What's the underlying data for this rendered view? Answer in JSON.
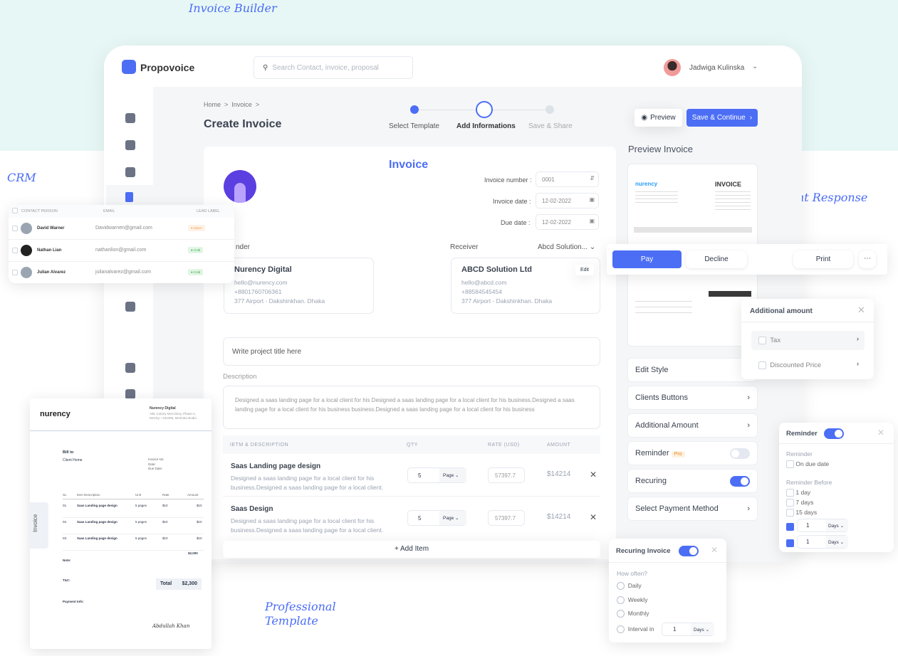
{
  "annotations": {
    "builder": "Invoice Builder",
    "crm": "CRM",
    "client_response": "Client Response",
    "template": "Professional Template"
  },
  "header": {
    "brand": "Propovoice",
    "search_placeholder": "Search Contact, invoice, proposal",
    "user": "Jadwiga Kulinska"
  },
  "breadcrumb": [
    "Home",
    "Invoice"
  ],
  "page_title": "Create Invoice",
  "steps": [
    {
      "label": "Select Template",
      "state": "done"
    },
    {
      "label": "Add Informations",
      "state": "current"
    },
    {
      "label": "Save & Share",
      "state": "todo"
    }
  ],
  "actions": {
    "preview": "Preview",
    "save": "Save & Continue"
  },
  "form": {
    "title": "Invoice",
    "invoice_number_label": "Invoice number :",
    "invoice_number": "0001",
    "invoice_date_label": "Invoice date :",
    "invoice_date": "12-02-2022",
    "due_date_label": "Due date :",
    "due_date": "12-02-2022",
    "sender_label": "nder",
    "receiver_label": "Receiver",
    "receiver_select": "Abcd Solution...",
    "sender": {
      "name": "Nurency Digital",
      "email": "hello@nurency.com",
      "phone": "+8801760706361",
      "address": "377 Airport - Dakshinkhan. Dhaka"
    },
    "receiver": {
      "name": "ABCD Solution Ltd",
      "email": "hello@abcd.com",
      "phone": "+88584545454",
      "address": "377 Airport - Dakshinkhan. Dhaka",
      "edit": "Edit"
    },
    "project_title_placeholder": "Write project title here",
    "description_label": "Description",
    "description": "Designed a saas landing page for a local client for his  Designed a saas landing page for a local client for his business.Designed a saas landing page for a local client for his business business.Designed a saas landing page for a local client for his business",
    "columns": [
      "IETM & DESCRIPTION",
      "QTY",
      "RATE (USD)",
      "AMOUNT"
    ],
    "items": [
      {
        "title": "Saas Landing page design",
        "desc": "Designed a saas landing page for a local client for his business.Designed a saas landing page for a local client.",
        "qty": "5",
        "unit": "Page",
        "rate": "57397.7",
        "amount": "$14214"
      },
      {
        "title": "Saas Design",
        "desc": "Designed a saas landing page for a local client for his business.Designed a saas landing page for a local client.",
        "qty": "5",
        "unit": "Page",
        "rate": "57397.7",
        "amount": "$14214"
      }
    ],
    "add_item": "Add Item"
  },
  "preview": {
    "title": "Preview Invoice",
    "mini_brand": "nurency",
    "mini_heading": "INVOICE"
  },
  "settings": [
    {
      "label": "Edit Style"
    },
    {
      "label": "Clients Buttons"
    },
    {
      "label": "Additional Amount"
    },
    {
      "label": "Reminder",
      "badge": "Pro",
      "toggle": false
    },
    {
      "label": "Recuring",
      "toggle": true
    },
    {
      "label": "Select Payment Method"
    }
  ],
  "client_response": {
    "pay": "Pay",
    "decline": "Decline",
    "print": "Print"
  },
  "additional": {
    "title": "Additional amount",
    "options": [
      "Tax",
      "Discounted Price"
    ]
  },
  "reminder": {
    "title": "Reminder",
    "enabled": true,
    "section1": "Reminder",
    "on_due": "On due date",
    "section2": "Reminder Before",
    "options": [
      "1 day",
      "7 days",
      "15 days"
    ],
    "custom": [
      {
        "value": "1",
        "unit": "Days"
      },
      {
        "value": "1",
        "unit": "Days"
      }
    ]
  },
  "recurring": {
    "title": "Recuring Invoice",
    "enabled": true,
    "question": "How often?",
    "options": [
      "Daily",
      "Weekly",
      "Monthly",
      "Interval in"
    ],
    "interval": "1",
    "interval_unit": "Days"
  },
  "crm": {
    "columns": [
      "CONTACT PERSON",
      "EMAIL",
      "LEAD LABEL"
    ],
    "rows": [
      {
        "name": "David Warner",
        "email": "Davidwarnen@gmail.com",
        "label": "Warm",
        "color": "#f6a04d"
      },
      {
        "name": "Nathan Lian",
        "email": "nathanlion@gmail.com",
        "label": "Cold",
        "color": "#2fb344"
      },
      {
        "name": "Julian Alvarez",
        "email": "julianalvarez@gmail.com",
        "label": "Cold",
        "color": "#2fb344"
      }
    ]
  },
  "template": {
    "brand": "nurency",
    "company": "Nurency Digital",
    "company_addr": "ABL Colony McColony, Phase-1, McCity—102456, McGrato Bodia",
    "side_tab": "Invoice",
    "bill_to": "Bill to",
    "client": "Client Home",
    "invoice_no": "Invoice No:",
    "date": "Date:",
    "due": "Due Date:",
    "columns": [
      "SL.",
      "Item Description",
      "Unit",
      "Rate",
      "Amount"
    ],
    "rows": [
      {
        "sl": "01.",
        "item": "Saas Landing page design",
        "unit": "5 pages",
        "rate": "$10",
        "amount": "$10"
      },
      {
        "sl": "02.",
        "item": "Saas Landing page design",
        "unit": "5 pages",
        "rate": "$10",
        "amount": "$10"
      },
      {
        "sl": "03.",
        "item": "Saas Landing page design",
        "unit": "5 pages",
        "rate": "$10",
        "amount": "$10"
      }
    ],
    "note": "Note:",
    "tips": "T&C:",
    "payment": "Payment Info:",
    "total_label": "Total",
    "total": "$2,300",
    "subtotal": "$2,000",
    "signature": "Abdullah Khan"
  },
  "colors": {
    "accent": "#4c6ef5",
    "mint": "#e7f7f5"
  }
}
